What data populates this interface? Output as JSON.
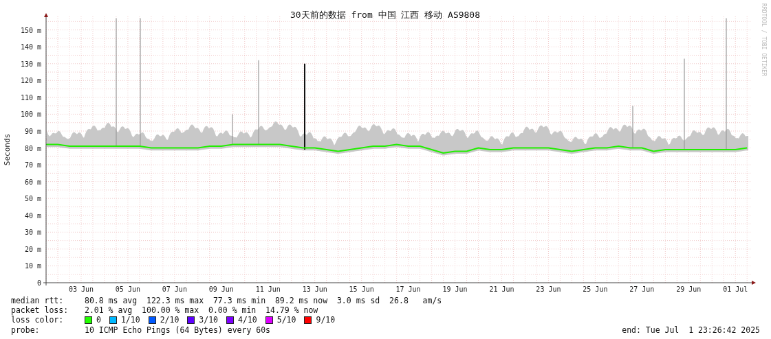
{
  "chart": {
    "title": "30天前的数据 from 中国 江西 移动 AS9808",
    "watermark": "RRDTOOL / TOBI OETIKER",
    "chart_data": {
      "type": "line",
      "ylabel": "Seconds",
      "categories": [
        null,
        null,
        null,
        "03 Jun",
        null,
        null,
        null,
        "05 Jun",
        null,
        null,
        null,
        "07 Jun",
        null,
        null,
        null,
        "09 Jun",
        null,
        null,
        null,
        "11 Jun",
        null,
        null,
        null,
        "13 Jun",
        null,
        null,
        null,
        "15 Jun",
        null,
        null,
        null,
        "17 Jun",
        null,
        null,
        null,
        "19 Jun",
        null,
        null,
        null,
        "21 Jun",
        null,
        null,
        null,
        "23 Jun",
        null,
        null,
        null,
        "25 Jun",
        null,
        null,
        null,
        "27 Jun",
        null,
        null,
        null,
        "29 Jun",
        null,
        null,
        null,
        "01 Jul",
        null
      ],
      "series": [
        {
          "name": "median rtt:",
          "color": "#22ee00",
          "values": [
            82,
            82,
            81,
            81,
            81,
            81,
            81,
            81,
            81,
            80,
            80,
            80,
            80,
            80,
            81,
            81,
            82,
            82,
            82,
            82,
            82,
            81,
            80,
            80,
            79,
            78,
            79,
            80,
            81,
            81,
            82,
            81,
            81,
            79,
            77,
            78,
            78,
            80,
            79,
            79,
            80,
            80,
            80,
            80,
            79,
            78,
            79,
            80,
            80,
            81,
            80,
            80,
            78,
            79,
            79,
            79,
            79,
            79,
            79,
            79,
            80
          ]
        }
      ],
      "ylim": [
        0,
        158
      ],
      "grid": true,
      "yticks": [
        {
          "value": 0,
          "label": "0"
        },
        {
          "value": 10,
          "label": "10 m"
        },
        {
          "value": 20,
          "label": "20 m"
        },
        {
          "value": 30,
          "label": "30 m"
        },
        {
          "value": 40,
          "label": "40 m"
        },
        {
          "value": 50,
          "label": "50 m"
        },
        {
          "value": 60,
          "label": "60 m"
        },
        {
          "value": 70,
          "label": "70 m"
        },
        {
          "value": 80,
          "label": "80 m"
        },
        {
          "value": 90,
          "label": "90 m"
        },
        {
          "value": 100,
          "label": "100 m"
        },
        {
          "value": 110,
          "label": "110 m"
        },
        {
          "value": 120,
          "label": "120 m"
        },
        {
          "value": 130,
          "label": "130 m"
        },
        {
          "value": 140,
          "label": "140 m"
        },
        {
          "value": 150,
          "label": "150 m"
        }
      ]
    }
  },
  "legend": {
    "median_rtt": {
      "text": "80.8 ms avg  122.3 ms max  77.3 ms min  89.2 ms now  3.0 ms sd  26.8   am/s"
    },
    "packet_loss": {
      "label": "packet loss:",
      "text": "2.01 % avg  100.00 % max  0.00 % min  14.79 % now"
    },
    "loss_color": {
      "label": "loss color:",
      "items": [
        {
          "label": "0",
          "color": "#22ff00"
        },
        {
          "label": "1/10",
          "color": "#00b8ff"
        },
        {
          "label": "2/10",
          "color": "#0059ff"
        },
        {
          "label": "3/10",
          "color": "#5e00ff"
        },
        {
          "label": "4/10",
          "color": "#7e00ff"
        },
        {
          "label": "5/10",
          "color": "#dd00ff"
        },
        {
          "label": "9/10",
          "color": "#ff0000"
        }
      ]
    },
    "probe": {
      "label": "probe:",
      "text": "10 ICMP Echo Pings (64 Bytes) every 60s"
    },
    "end": "end: Tue Jul  1 23:26:42 2025"
  }
}
